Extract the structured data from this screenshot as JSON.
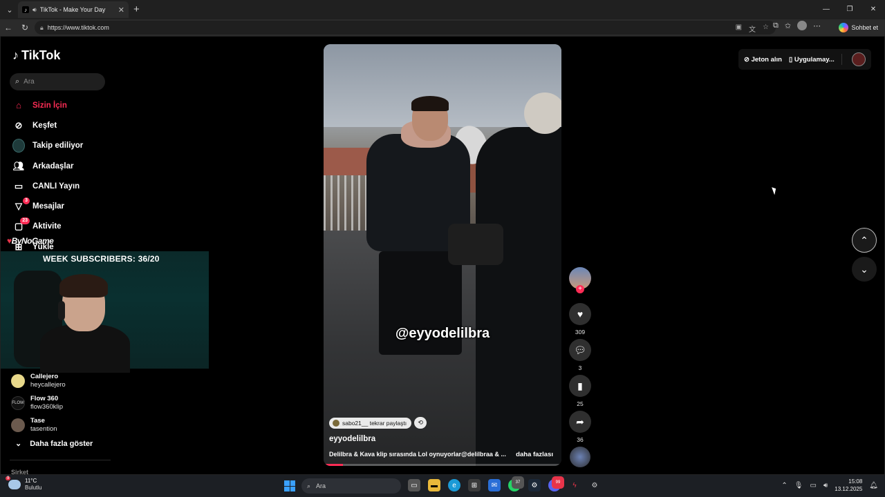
{
  "browser": {
    "tab_title": "TikTok - Make Your Day",
    "url": "https://www.tiktok.com",
    "copilot_label": "Sohbet et"
  },
  "sidebar": {
    "logo_text": "TikTok",
    "search_placeholder": "Ara",
    "nav": [
      {
        "label": "Sizin İçin",
        "icon": "home-icon",
        "badge": ""
      },
      {
        "label": "Keşfet",
        "icon": "compass-icon",
        "badge": ""
      },
      {
        "label": "Takip ediliyor",
        "icon": "following-icon",
        "badge": ""
      },
      {
        "label": "Arkadaşlar",
        "icon": "friends-icon",
        "badge": ""
      },
      {
        "label": "CANLI Yayın",
        "icon": "live-icon",
        "badge": ""
      },
      {
        "label": "Mesajlar",
        "icon": "messages-icon",
        "badge": "3"
      },
      {
        "label": "Aktivite",
        "icon": "activity-icon",
        "badge": "23"
      },
      {
        "label": "Yükle",
        "icon": "upload-icon",
        "badge": ""
      }
    ],
    "following_accounts": [
      {
        "name": "Callejero",
        "handle": "heycallejero"
      },
      {
        "name": "Flow 360",
        "handle": "flow360klip"
      },
      {
        "name": "Tase",
        "handle": "tasention"
      }
    ],
    "show_more_label": "Daha fazla göster",
    "company_label": "Şirket"
  },
  "stream_overlay": {
    "brand": "ByNoGame",
    "subscribers_text": "WEEK SUBSCRIBERS: 36/20"
  },
  "video": {
    "overlay_handle": "@eyyodelilbra",
    "repost_label": "sabo21__ tekrar paylaştı",
    "author": "eyyodelilbra",
    "description": "Delilbra & Kava klip sırasında Lol oynuyorlar@delilbraa & ...",
    "more_label": "daha fazlası",
    "progress": 0.08
  },
  "actions": {
    "likes": "309",
    "comments": "3",
    "saves": "25",
    "shares": "36"
  },
  "topbar": {
    "coins_label": "Jeton alın",
    "app_label": "Uygulamay..."
  },
  "taskbar": {
    "temperature": "11°C",
    "weather": "Bulutlu",
    "weather_badge": "9",
    "search_placeholder": "Ara",
    "time": "15:08",
    "date": "13.12.2025",
    "whatsapp_count": "37",
    "discord_count": "99"
  }
}
